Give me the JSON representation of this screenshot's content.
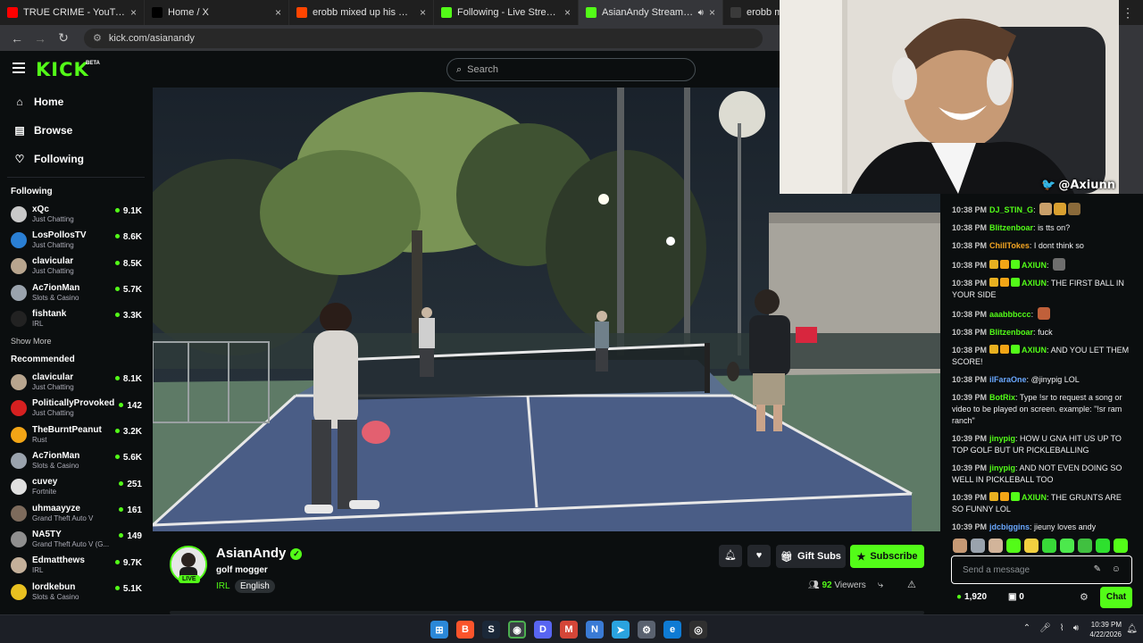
{
  "browser": {
    "tabs": [
      {
        "title": "TRUE CRIME - YouTube",
        "color": "#ff0000",
        "active": false
      },
      {
        "title": "Home / X",
        "color": "#000000",
        "active": false
      },
      {
        "title": "erobb mixed up his wives : r/Li",
        "color": "#ff4500",
        "active": false
      },
      {
        "title": "Following - Live Streams on Kic",
        "color": "#53fc18",
        "active": false
      },
      {
        "title": "AsianAndy Stream - Watch",
        "color": "#53fc18",
        "active": true
      },
      {
        "title": "erobb mixed u",
        "color": "#3a3a3a",
        "active": false
      }
    ],
    "url": "kick.com/asianandy"
  },
  "kick": {
    "logo": "KICK",
    "beta": "BETA",
    "search_placeholder": "Search",
    "nav": [
      {
        "label": "Home",
        "icon": "home-icon",
        "glyph": "⌂"
      },
      {
        "label": "Browse",
        "icon": "browse-icon",
        "glyph": "▤"
      },
      {
        "label": "Following",
        "icon": "heart-icon",
        "glyph": "♡"
      }
    ],
    "following_heading": "Following",
    "following": [
      {
        "name": "xQc",
        "category": "Just Chatting",
        "viewers": "9.1K",
        "color": "#c9c9c9"
      },
      {
        "name": "LosPollosTV",
        "category": "Just Chatting",
        "viewers": "8.6K",
        "color": "#2a7fd4"
      },
      {
        "name": "clavicular",
        "category": "Just Chatting",
        "viewers": "8.5K",
        "color": "#b8a58e"
      },
      {
        "name": "Ac7ionMan",
        "category": "Slots & Casino",
        "viewers": "5.7K",
        "color": "#9aa3ad"
      },
      {
        "name": "fishtank",
        "category": "IRL",
        "viewers": "3.3K",
        "color": "#222222"
      }
    ],
    "show_more": "Show More",
    "recommended_heading": "Recommended",
    "recommended": [
      {
        "name": "clavicular",
        "category": "Just Chatting",
        "viewers": "8.1K",
        "color": "#b8a58e"
      },
      {
        "name": "PoliticallyProvoked",
        "category": "Just Chatting",
        "viewers": "142",
        "color": "#d62020"
      },
      {
        "name": "TheBurntPeanut",
        "category": "Rust",
        "viewers": "3.2K",
        "color": "#f2a516"
      },
      {
        "name": "Ac7ionMan",
        "category": "Slots & Casino",
        "viewers": "5.6K",
        "color": "#9aa3ad"
      },
      {
        "name": "cuvey",
        "category": "Fortnite",
        "viewers": "251",
        "color": "#e0e0e0"
      },
      {
        "name": "uhmaayyze",
        "category": "Grand Theft Auto V",
        "viewers": "161",
        "color": "#7d6b5c"
      },
      {
        "name": "NA5TY",
        "category": "Grand Theft Auto V (G...",
        "viewers": "149",
        "color": "#8f8f8f"
      },
      {
        "name": "Edmatthews",
        "category": "IRL",
        "viewers": "9.7K",
        "color": "#c4b09a"
      },
      {
        "name": "lordkebun",
        "category": "Slots & Casino",
        "viewers": "5.1K",
        "color": "#e8c020"
      }
    ]
  },
  "cam_tag": "@Axiunn",
  "channel": {
    "name": "AsianAndy",
    "live_label": "LIVE",
    "stream_title": "golf mogger",
    "category": "IRL",
    "tag": "English",
    "gift_subs": "Gift Subs",
    "subscribe": "Subscribe",
    "viewers": "92",
    "viewers_label": "Viewers"
  },
  "chat": {
    "messages": [
      {
        "time": "10:38 PM",
        "user": "DJ_STIN_G",
        "color": "#53fc18",
        "text": "",
        "emotes": [
          "#c9a06a",
          "#d9a030",
          "#8a6a3a"
        ]
      },
      {
        "time": "10:38 PM",
        "user": "Blitzenboar",
        "color": "#53fc18",
        "text": "is tts on?",
        "emotes": []
      },
      {
        "time": "10:38 PM",
        "user": "ChillTokes",
        "color": "#f5a623",
        "text": "I dont think so",
        "emotes": []
      },
      {
        "time": "10:38 PM",
        "user": "AXIUN",
        "color": "#53fc18",
        "text": "",
        "badges": true,
        "emotes": [
          "#6e6e6e"
        ]
      },
      {
        "time": "10:38 PM",
        "user": "AXIUN",
        "color": "#53fc18",
        "text": "THE FIRST BALL IN YOUR SIDE",
        "badges": true,
        "emotes": []
      },
      {
        "time": "10:38 PM",
        "user": "aaabbbccc",
        "color": "#53fc18",
        "text": "",
        "emotes": [
          "#c0603a"
        ]
      },
      {
        "time": "10:38 PM",
        "user": "Blitzenboar",
        "color": "#53fc18",
        "text": "fuck",
        "emotes": []
      },
      {
        "time": "10:38 PM",
        "user": "AXIUN",
        "color": "#53fc18",
        "text": "AND YOU LET THEM SCORE!",
        "badges": true,
        "emotes": []
      },
      {
        "time": "10:38 PM",
        "user": "ilFaraOne",
        "color": "#6aa8ff",
        "text": "@jinypig LOL",
        "emotes": []
      },
      {
        "time": "10:39 PM",
        "user": "BotRix",
        "color": "#53fc18",
        "text": "Type !sr to request a song or video to be played on screen. example: \"!sr ram ranch\"",
        "emotes": []
      },
      {
        "time": "10:39 PM",
        "user": "jinypig",
        "color": "#53fc18",
        "text": "HOW U GNA HIT US UP TO TOP GOLF BUT UR PICKLEBALLING",
        "emotes": []
      },
      {
        "time": "10:39 PM",
        "user": "jinypig",
        "color": "#53fc18",
        "text": "AND NOT EVEN DOING SO WELL IN PICKLEBALL TOO",
        "emotes": []
      },
      {
        "time": "10:39 PM",
        "user": "AXIUN",
        "color": "#53fc18",
        "text": "THE GRUNTS ARE SO FUNNY LOL",
        "badges": true,
        "emotes": []
      },
      {
        "time": "10:39 PM",
        "user": "jdcbiggins",
        "color": "#6aa8ff",
        "text": "jieuny loves andy",
        "emotes": []
      }
    ],
    "input_placeholder": "Send a message",
    "points": "1,920",
    "count": "0",
    "chat_button": "Chat"
  },
  "taskbar": {
    "time": "10:39 PM",
    "date": "4/22/2026"
  }
}
